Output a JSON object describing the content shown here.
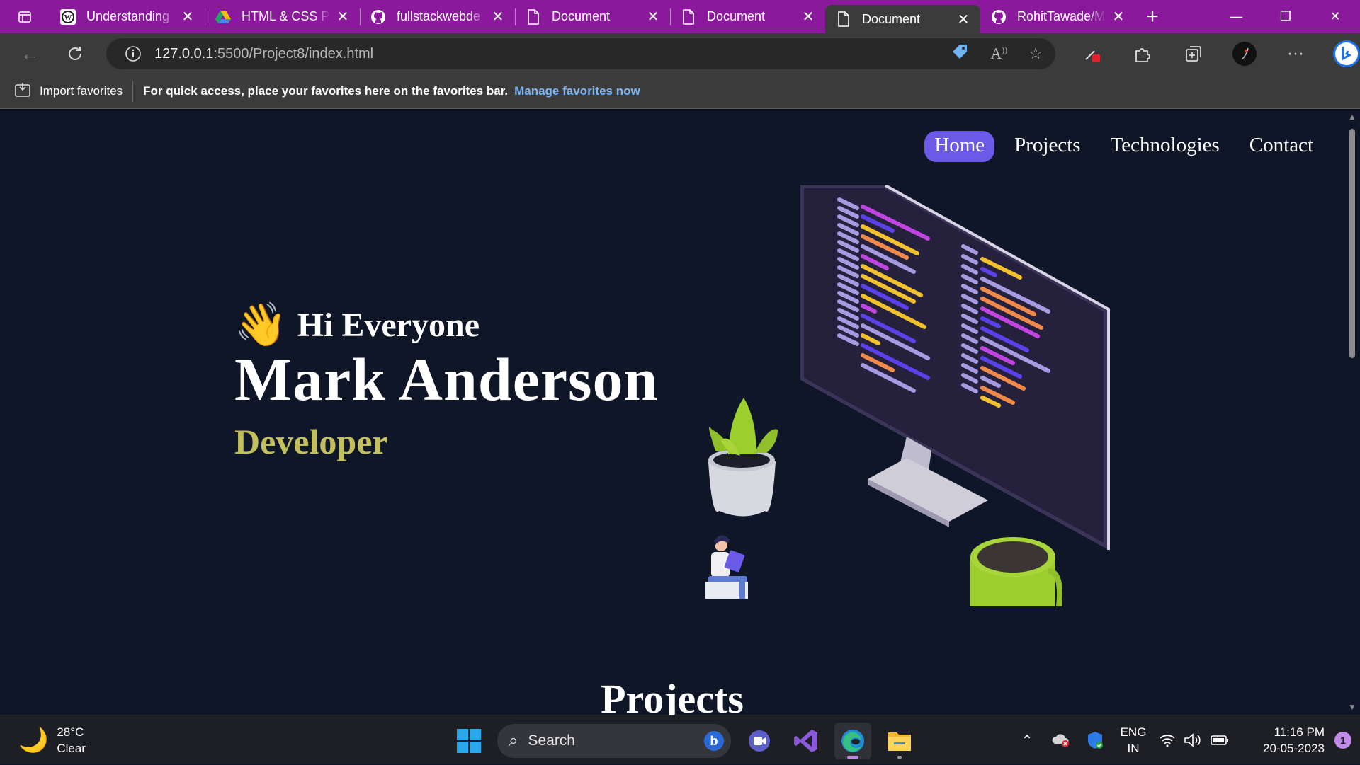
{
  "browser": {
    "tabs": [
      {
        "title": "Understanding",
        "favicon": "wordpress-icon",
        "active": false
      },
      {
        "title": "HTML & CSS Pr",
        "favicon": "google-drive-icon",
        "active": false
      },
      {
        "title": "fullstackwebde",
        "favicon": "github-icon",
        "active": false
      },
      {
        "title": "Document",
        "favicon": "document-icon",
        "active": false
      },
      {
        "title": "Document",
        "favicon": "document-icon",
        "active": false
      },
      {
        "title": "Document",
        "favicon": "document-icon",
        "active": true
      },
      {
        "title": "RohitTawade/M",
        "favicon": "github-icon",
        "active": false
      }
    ],
    "url_host": "127.0.0.1",
    "url_path": ":5500/Project8/index.html",
    "favorites": {
      "import_label": "Import favorites",
      "message": "For quick access, place your favorites here on the favorites bar.",
      "link": "Manage favorites now"
    }
  },
  "page": {
    "nav": [
      "Home",
      "Projects",
      "Technologies",
      "Contact"
    ],
    "active_nav": "Home",
    "greeting": "Hi Everyone",
    "wave_emoji": "👋",
    "name": "Mark Anderson",
    "role": "Developer",
    "section_title": "Projects",
    "colors": {
      "background": "#0e1628",
      "accent": "#6b5ae8",
      "role": "#c4bf5d"
    }
  },
  "taskbar": {
    "weather_temp": "28°C",
    "weather_desc": "Clear",
    "search_label": "Search",
    "lang_top": "ENG",
    "lang_bottom": "IN",
    "time": "11:16 PM",
    "date": "20-05-2023",
    "notification_count": "1"
  }
}
